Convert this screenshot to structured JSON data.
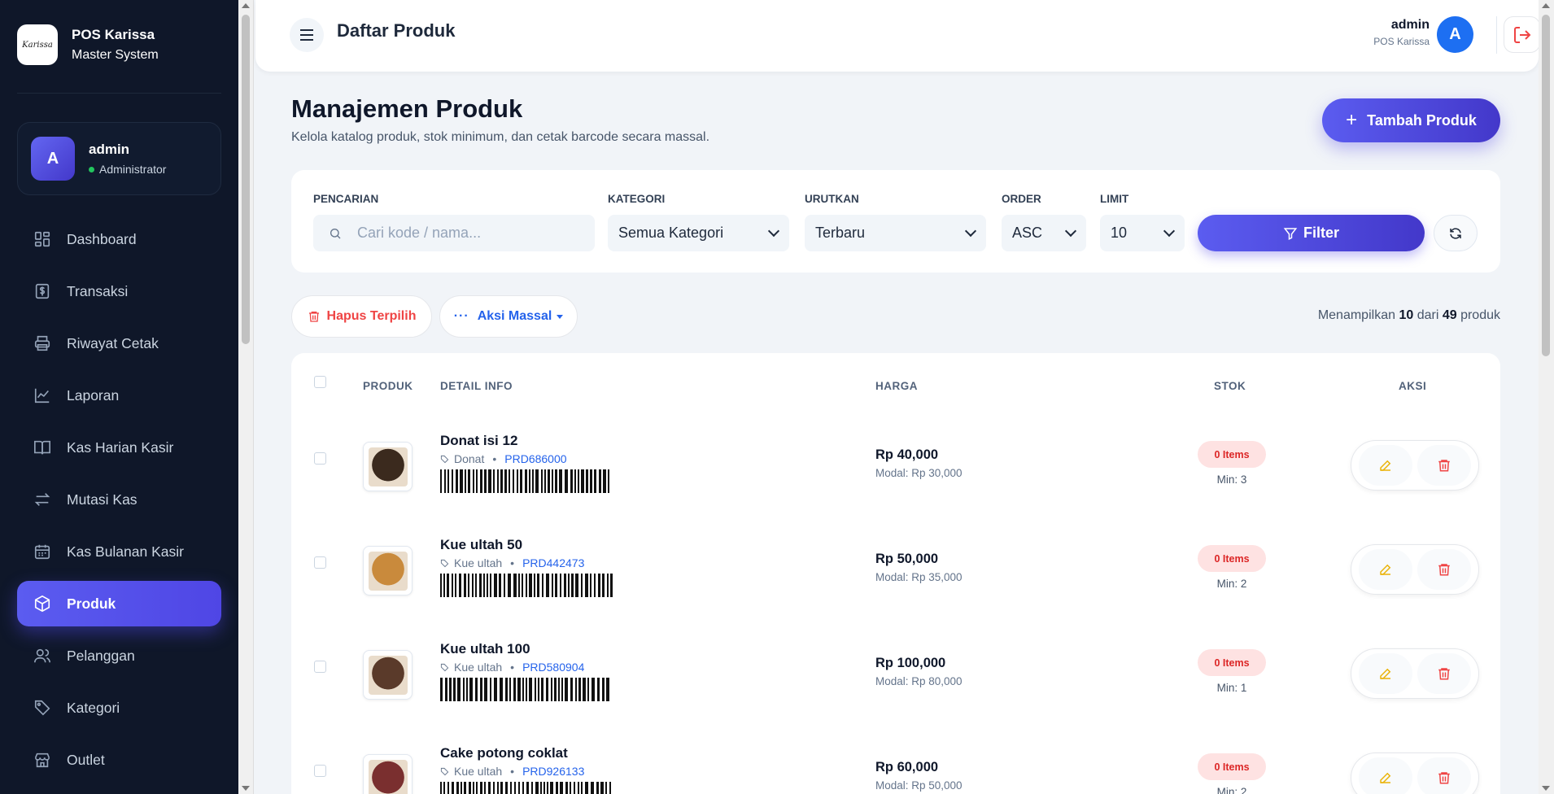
{
  "brand": {
    "logo_text": "Karissa",
    "title": "POS Karissa",
    "subtitle": "Master System"
  },
  "user": {
    "avatar": "A",
    "name": "admin",
    "role": "Administrator"
  },
  "nav": [
    {
      "label": "Dashboard",
      "icon": "dashboard-icon",
      "active": false
    },
    {
      "label": "Transaksi",
      "icon": "dollar-icon",
      "active": false
    },
    {
      "label": "Riwayat Cetak",
      "icon": "printer-icon",
      "active": false
    },
    {
      "label": "Laporan",
      "icon": "chart-line-icon",
      "active": false
    },
    {
      "label": "Kas Harian Kasir",
      "icon": "book-icon",
      "active": false
    },
    {
      "label": "Mutasi Kas",
      "icon": "arrows-icon",
      "active": false
    },
    {
      "label": "Kas Bulanan Kasir",
      "icon": "calendar-icon",
      "active": false
    },
    {
      "label": "Produk",
      "icon": "box-icon",
      "active": true
    },
    {
      "label": "Pelanggan",
      "icon": "users-icon",
      "active": false
    },
    {
      "label": "Kategori",
      "icon": "tag-icon",
      "active": false
    },
    {
      "label": "Outlet",
      "icon": "store-icon",
      "active": false
    }
  ],
  "header": {
    "title": "Daftar Produk",
    "user_name": "admin",
    "user_sub": "POS Karissa",
    "avatar": "A"
  },
  "page": {
    "title": "Manajemen Produk",
    "subtitle": "Kelola katalog produk, stok minimum, dan cetak barcode secara massal.",
    "add_button": "Tambah Produk"
  },
  "filters": {
    "search_label": "PENCARIAN",
    "search_placeholder": "Cari kode / nama...",
    "category_label": "KATEGORI",
    "category_value": "Semua Kategori",
    "sort_label": "URUTKAN",
    "sort_value": "Terbaru",
    "order_label": "ORDER",
    "order_value": "ASC",
    "limit_label": "LIMIT",
    "limit_value": "10",
    "filter_button": "Filter"
  },
  "bulk": {
    "delete_label": "Hapus Terpilih",
    "actions_label": "Aksi Massal"
  },
  "count": {
    "prefix": "Menampilkan",
    "shown": "10",
    "mid": "dari",
    "total": "49",
    "suffix": "produk"
  },
  "table": {
    "headers": {
      "product": "PRODUK",
      "detail": "DETAIL INFO",
      "price": "HARGA",
      "stock": "STOK",
      "action": "AKSI"
    },
    "rows": [
      {
        "name": "Donat isi 12",
        "category": "Donat",
        "code": "PRD686000",
        "price": "Rp 40,000",
        "modal": "Modal: Rp 30,000",
        "stock": "0 Items",
        "min": "Min: 3",
        "img_color": "#3b2a1e"
      },
      {
        "name": "Kue ultah 50",
        "category": "Kue ultah",
        "code": "PRD442473",
        "price": "Rp 50,000",
        "modal": "Modal: Rp 35,000",
        "stock": "0 Items",
        "min": "Min: 2",
        "img_color": "#c98a3c"
      },
      {
        "name": "Kue ultah 100",
        "category": "Kue ultah",
        "code": "PRD580904",
        "price": "Rp 100,000",
        "modal": "Modal: Rp 80,000",
        "stock": "0 Items",
        "min": "Min: 1",
        "img_color": "#5a3a2a"
      },
      {
        "name": "Cake potong coklat",
        "category": "Kue ultah",
        "code": "PRD926133",
        "price": "Rp 60,000",
        "modal": "Modal: Rp 50,000",
        "stock": "0 Items",
        "min": "Min: 2",
        "img_color": "#7a2f2f"
      }
    ]
  }
}
